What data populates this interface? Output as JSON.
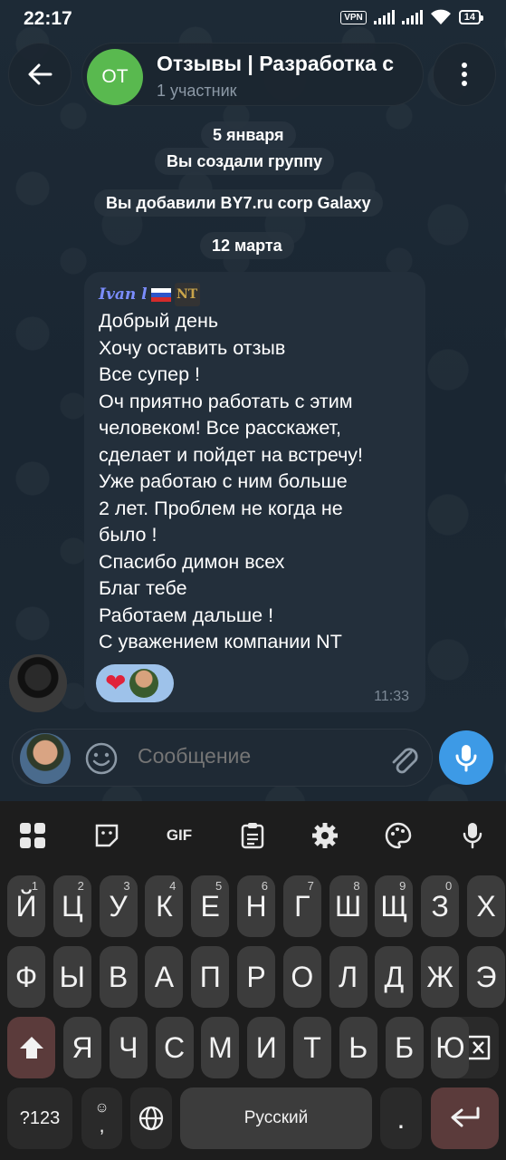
{
  "status": {
    "time": "22:17",
    "vpn": "VPN",
    "battery": "14"
  },
  "header": {
    "avatar_initials": "ОТ",
    "title": "Отзывы | Разработка с",
    "subtitle": "1 участник"
  },
  "service": {
    "date1": "5 января",
    "created": "Вы создали группу",
    "added": "Вы добавили BY7.ru corp Galaxy",
    "date2": "12 марта"
  },
  "message": {
    "sender": "Ivan l",
    "sender_badge": "NT",
    "lines": [
      "Добрый день",
      "Хочу оставить отзыв",
      "Все супер !",
      "Оч приятно работать с этим",
      "человеком! Все расскажет,",
      "сделает и пойдет на встречу!",
      "Уже работаю с ним больше",
      "2 лет. Проблем не когда не",
      "было !",
      "Спасибо димон всех",
      "Благ тебе",
      "Работаем дальше !",
      "С уважением компании NT"
    ],
    "reaction": "❤",
    "time": "11:33"
  },
  "input": {
    "placeholder": "Сообщение"
  },
  "keyboard": {
    "toolbar": [
      "apps-icon",
      "sticker-icon",
      "GIF",
      "clipboard-icon",
      "settings-icon",
      "palette-icon",
      "mic-icon"
    ],
    "gif_label": "GIF",
    "row1": [
      "Й",
      "Ц",
      "У",
      "К",
      "Е",
      "Н",
      "Г",
      "Ш",
      "Щ",
      "З",
      "Х"
    ],
    "row1_hints": [
      "1",
      "2",
      "3",
      "4",
      "5",
      "6",
      "7",
      "8",
      "9",
      "0",
      ""
    ],
    "row2": [
      "Ф",
      "Ы",
      "В",
      "А",
      "П",
      "Р",
      "О",
      "Л",
      "Д",
      "Ж",
      "Э"
    ],
    "row3": [
      "Я",
      "Ч",
      "С",
      "М",
      "И",
      "Т",
      "Ь",
      "Б",
      "Ю"
    ],
    "symbols_key": "?123",
    "comma_key": ",",
    "space_label": "Русский",
    "period_key": "."
  }
}
